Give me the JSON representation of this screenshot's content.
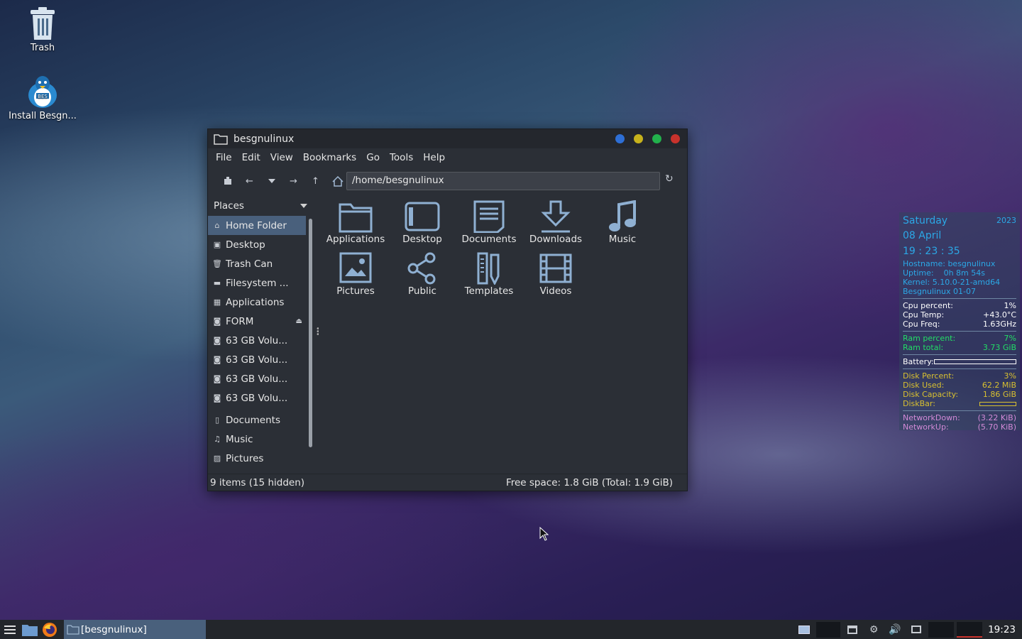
{
  "desktop": {
    "icons": [
      {
        "label": "Trash",
        "icon": "trash-icon"
      },
      {
        "label": "Install Besgn...",
        "icon": "tux-installer-icon"
      }
    ]
  },
  "window": {
    "title": "besgnulinux",
    "controls": [
      {
        "name": "minimize",
        "color": "#2e6fd6"
      },
      {
        "name": "maximize",
        "color": "#c7b21c"
      },
      {
        "name": "restore",
        "color": "#22b14c"
      },
      {
        "name": "close",
        "color": "#c8322c"
      }
    ],
    "menu": [
      "File",
      "Edit",
      "View",
      "Bookmarks",
      "Go",
      "Tools",
      "Help"
    ],
    "path": "/home/besgnulinux",
    "sidebar": {
      "header": "Places",
      "items": [
        {
          "label": "Home Folder",
          "icon": "home-icon",
          "selected": true
        },
        {
          "label": "Desktop",
          "icon": "desktop-icon"
        },
        {
          "label": "Trash Can",
          "icon": "trash-icon"
        },
        {
          "label": "Filesystem ...",
          "icon": "drive-icon"
        },
        {
          "label": "Applications",
          "icon": "apps-icon"
        },
        {
          "label": "FORM",
          "icon": "disk-icon",
          "eject": true
        },
        {
          "label": "63 GB Volu...",
          "icon": "disk-icon"
        },
        {
          "label": "63 GB Volu...",
          "icon": "disk-icon"
        },
        {
          "label": "63 GB Volu...",
          "icon": "disk-icon"
        },
        {
          "label": "63 GB Volu...",
          "icon": "disk-icon"
        },
        {
          "label": "Documents",
          "icon": "document-icon"
        },
        {
          "label": "Music",
          "icon": "music-icon"
        },
        {
          "label": "Pictures",
          "icon": "picture-icon"
        }
      ]
    },
    "files": [
      {
        "label": "Applications",
        "icon": "folder-icon"
      },
      {
        "label": "Desktop",
        "icon": "desktop-folder-icon"
      },
      {
        "label": "Documents",
        "icon": "documents-folder-icon"
      },
      {
        "label": "Downloads",
        "icon": "downloads-folder-icon"
      },
      {
        "label": "Music",
        "icon": "music-folder-icon"
      },
      {
        "label": "Pictures",
        "icon": "pictures-folder-icon"
      },
      {
        "label": "Public",
        "icon": "share-folder-icon"
      },
      {
        "label": "Templates",
        "icon": "templates-folder-icon"
      },
      {
        "label": "Videos",
        "icon": "videos-folder-icon"
      }
    ],
    "status_left": "9 items (15 hidden)",
    "status_right": "Free space: 1.8 GiB (Total: 1.9 GiB)"
  },
  "conky": {
    "day": "Saturday",
    "year": "2023",
    "date": "08 April",
    "time": "19 : 23 : 35",
    "hostname": "Hostname: besgnulinux",
    "uptime_label": "Uptime:",
    "uptime_value": "0h 8m 54s",
    "kernel": "Kernel: 5.10.0-21-amd64",
    "distro": "Besgnulinux 01-07",
    "cpu_percent_label": "Cpu percent:",
    "cpu_percent": "1%",
    "cpu_temp_label": "Cpu Temp:",
    "cpu_temp": "+43.0°C",
    "cpu_freq_label": "Cpu Freq:",
    "cpu_freq": "1.63GHz",
    "ram_percent_label": "Ram percent:",
    "ram_percent": "7%",
    "ram_total_label": "Ram total:",
    "ram_total": "3.73 GiB",
    "battery_label": "Battery:",
    "disk_percent_label": "Disk Percent:",
    "disk_percent": "3%",
    "disk_used_label": "Disk Used:",
    "disk_used": "62.2 MiB",
    "disk_capacity_label": "Disk Capacity:",
    "disk_capacity": "1.86 GiB",
    "diskbar_label": "DiskBar:",
    "net_down_label": "NetworkDown:",
    "net_down": "(3.22 KiB)",
    "net_up_label": "NetworkUp:",
    "net_up": "(5.70 KiB)"
  },
  "taskbar": {
    "task_label": "[besgnulinux]",
    "clock": "19:23"
  }
}
